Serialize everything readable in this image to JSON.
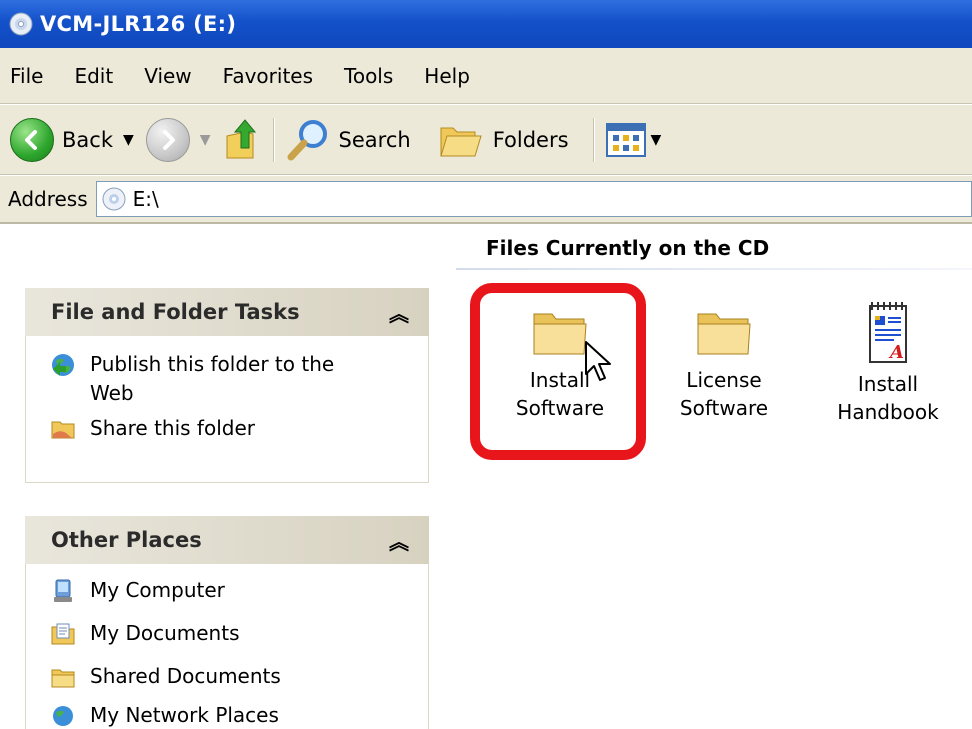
{
  "window": {
    "title": "VCM-JLR126 (E:)"
  },
  "menu": [
    "File",
    "Edit",
    "View",
    "Favorites",
    "Tools",
    "Help"
  ],
  "toolbar": {
    "back_label": "Back",
    "search_label": "Search",
    "folders_label": "Folders"
  },
  "address": {
    "label": "Address",
    "value": "E:\\"
  },
  "tasks_panel": {
    "title": "File and Folder Tasks",
    "items": [
      {
        "label": "Publish this folder to the Web",
        "icon": "publish-web-icon"
      },
      {
        "label": "Share this folder",
        "icon": "share-folder-icon"
      }
    ]
  },
  "places_panel": {
    "title": "Other Places",
    "items": [
      {
        "label": "My Computer",
        "icon": "my-computer-icon"
      },
      {
        "label": "My Documents",
        "icon": "my-documents-icon"
      },
      {
        "label": "Shared Documents",
        "icon": "shared-documents-icon"
      },
      {
        "label": "My Network Places",
        "icon": "network-places-icon"
      }
    ]
  },
  "files": {
    "header": "Files Currently on the CD",
    "items": [
      {
        "line1": "Install",
        "line2": "Software",
        "icon": "folder-icon"
      },
      {
        "line1": "License",
        "line2": "Software",
        "icon": "folder-icon"
      },
      {
        "line1": "Install",
        "line2": "Handbook",
        "icon": "document-icon"
      }
    ]
  },
  "colors": {
    "titlebar": "#1451c9",
    "chrome": "#ece9d8",
    "highlight": "#e8161b"
  }
}
